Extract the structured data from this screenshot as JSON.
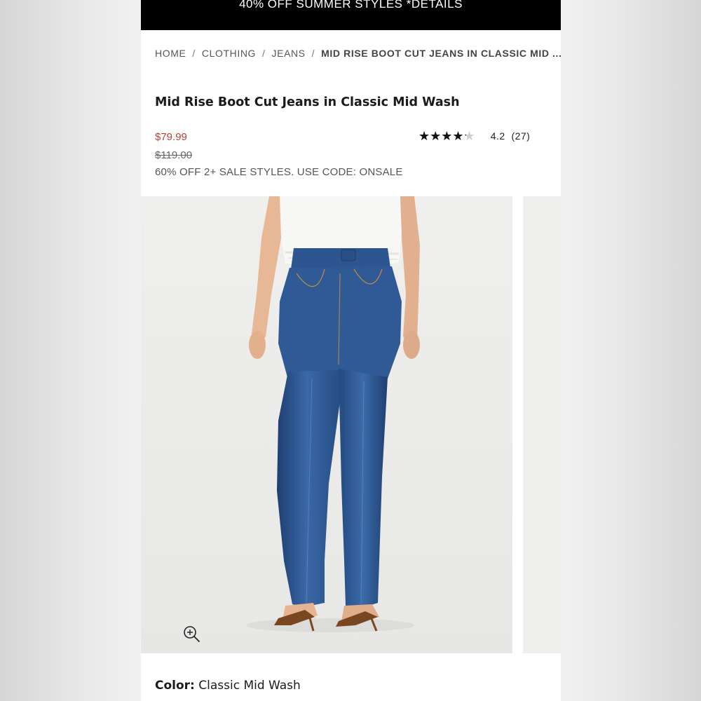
{
  "promo_banner": {
    "text": "40% OFF SUMMER STYLES *DETAILS"
  },
  "breadcrumb": {
    "items": [
      "HOME",
      "CLOTHING",
      "JEANS"
    ],
    "current": "MID RISE BOOT CUT JEANS IN CLASSIC MID ...",
    "separator": "/"
  },
  "product": {
    "title": "Mid Rise Boot Cut Jeans in Classic Mid Wash",
    "sale_price": "$79.99",
    "original_price": "$119.00",
    "promo": "60% OFF 2+ SALE STYLES. USE CODE: ONSALE",
    "rating": {
      "value": 4.2,
      "label": "4.2",
      "count": "(27)",
      "stars": "★★★★★"
    },
    "color_label": "Color:",
    "color_value": "Classic Mid Wash"
  },
  "icons": {
    "zoom": "zoom-in-icon",
    "star": "star-icon"
  },
  "colors": {
    "sale": "#b5413a",
    "banner_bg": "#000000",
    "denim": "#2f5a94"
  }
}
